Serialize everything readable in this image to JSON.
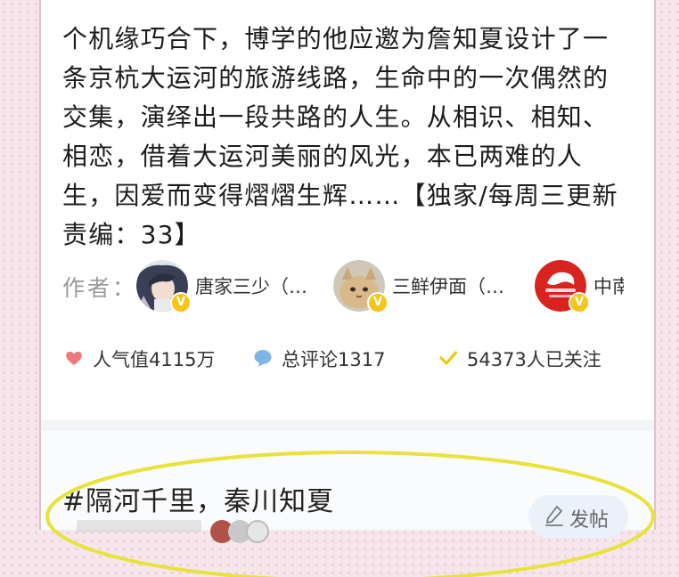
{
  "description": "个机缘巧合下，博学的他应邀为詹知夏设计了一条京杭大运河的旅游线路，生命中的一次偶然的交集，演绎出一段共路的人生。从相识、相知、相恋，借着大运河美丽的风光，本已两难的人生，因爱而变得熠熠生辉……【独家/每周三更新 责编：33】",
  "authors": {
    "label": "作者：",
    "items": [
      {
        "name": "唐家三少（…",
        "icon": "avatar-anime-character"
      },
      {
        "name": "三鲜伊面（…",
        "icon": "avatar-cat"
      },
      {
        "name": "中南",
        "icon": "avatar-zhongnan-logo"
      }
    ],
    "verified_badge": "V"
  },
  "stats": {
    "popularity": "人气值4115万",
    "comments": "总评论1317",
    "followers": "54373人已关注"
  },
  "topic": {
    "title": "#隔河千里，秦川知夏",
    "post_button": "发帖"
  },
  "colors": {
    "heart": "#f0787a",
    "comment_bubble": "#7fb4e6",
    "check": "#f2c811",
    "highlight_ring": "#e8e23a",
    "page_bg": "#f6e6ec"
  }
}
